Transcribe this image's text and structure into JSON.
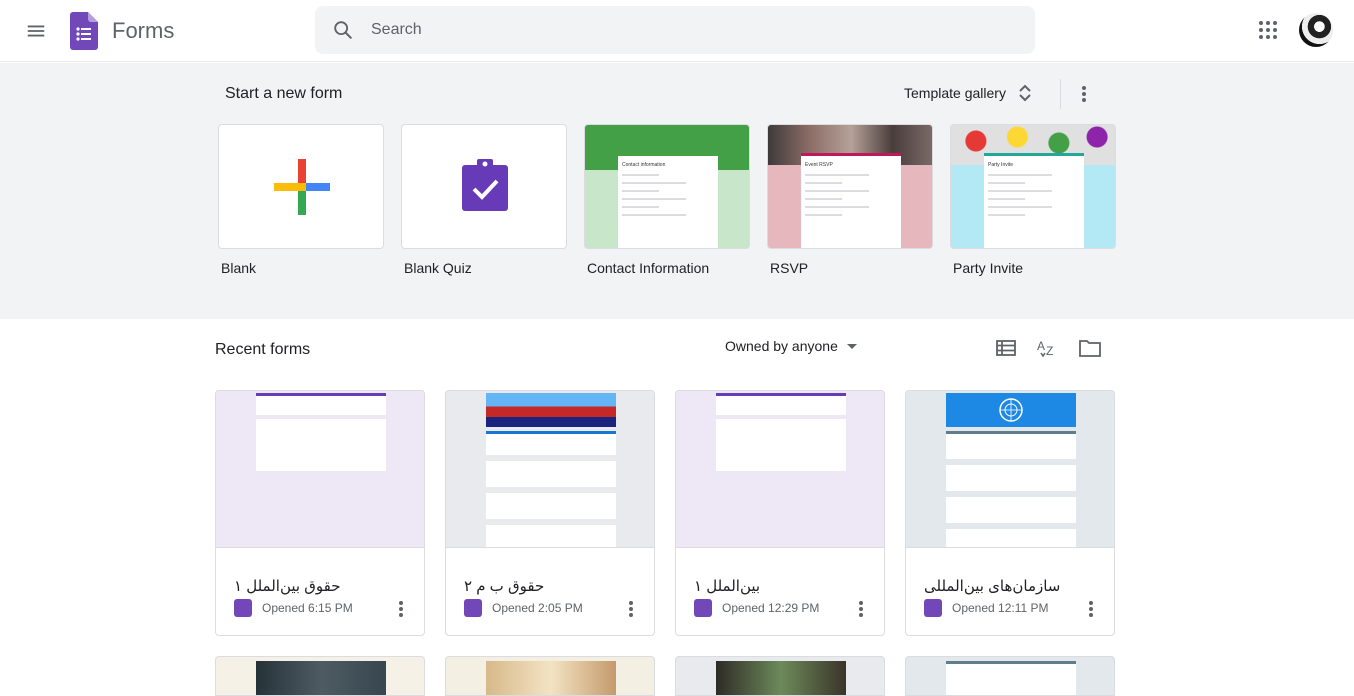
{
  "header": {
    "app_title": "Forms",
    "search_placeholder": "Search"
  },
  "start": {
    "title": "Start a new form",
    "gallery_label": "Template gallery",
    "templates": [
      {
        "label": "Blank"
      },
      {
        "label": "Blank Quiz"
      },
      {
        "label": "Contact Information",
        "mini_title": "Contact information"
      },
      {
        "label": "RSVP",
        "mini_title": "Event RSVP"
      },
      {
        "label": "Party Invite",
        "mini_title": "Party Invite"
      }
    ]
  },
  "recent": {
    "title": "Recent forms",
    "owner_filter": "Owned by anyone",
    "cards": [
      {
        "title": "حقوق بین‌الملل ۱",
        "meta": "Opened 6:15 PM"
      },
      {
        "title": "حقوق ب م ۲",
        "meta": "Opened 2:05 PM"
      },
      {
        "title": "بین‌الملل ۱",
        "meta": "Opened 12:29 PM"
      },
      {
        "title": "سازمان‌های بین‌المللی",
        "meta": "Opened 12:11 PM"
      }
    ]
  },
  "colors": {
    "forms_purple": "#673ab7",
    "header_bg": "#ffffff",
    "start_bg": "#f1f3f4",
    "contact_green": "#c8e6c9",
    "rsvp_pink": "#e6b8bd",
    "party_blue": "#b3e9f5"
  },
  "icons": [
    "menu-icon",
    "forms-logo-icon",
    "search-icon",
    "apps-icon",
    "unfold-icon",
    "more-vert-icon",
    "list-view-icon",
    "sort-az-icon",
    "folder-icon",
    "dropdown-arrow-icon"
  ]
}
